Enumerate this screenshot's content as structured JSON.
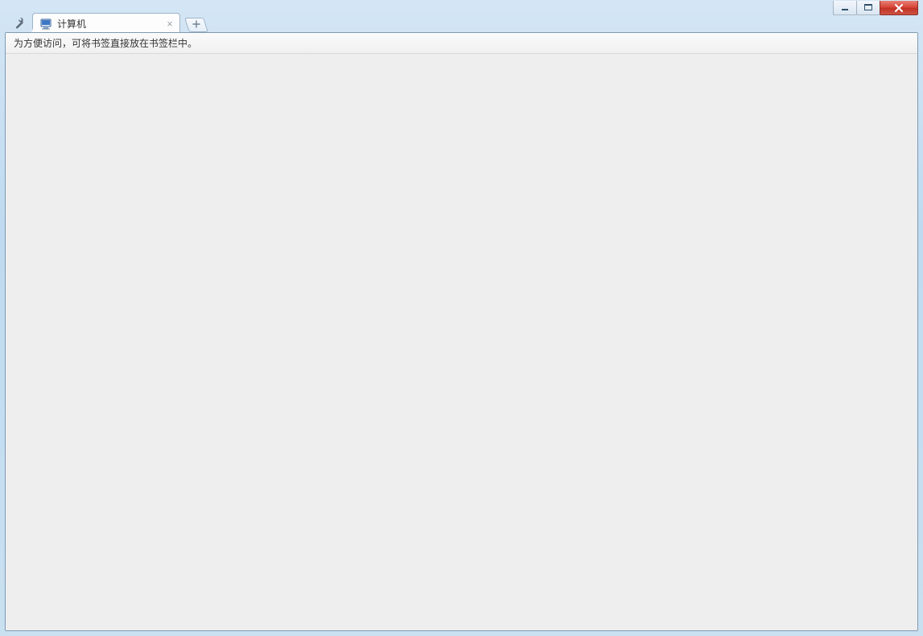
{
  "tab": {
    "title": "计算机",
    "favicon": "computer-icon"
  },
  "bookmark_bar": {
    "hint": "为方便访问，可将书签直接放在书签栏中。"
  },
  "icons": {
    "wrench": "wrench-icon",
    "close_tab": "×",
    "new_tab": "+"
  },
  "window_controls": {
    "minimize": "minimize",
    "maximize": "maximize",
    "close": "close"
  }
}
